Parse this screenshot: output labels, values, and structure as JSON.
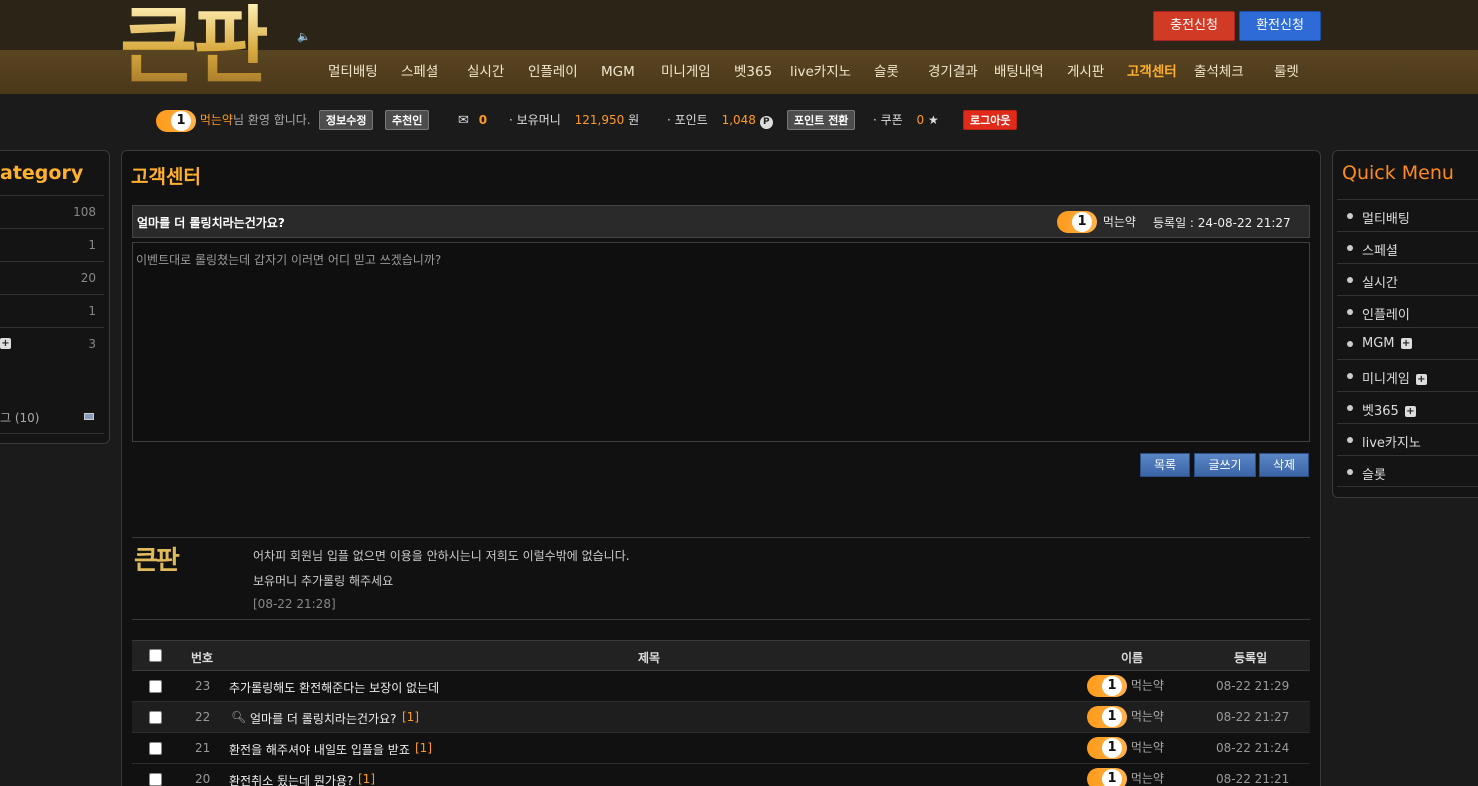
{
  "header": {
    "logo": "큰판",
    "charge_button": "충전신청",
    "exchange_button": "환전신청",
    "nav": [
      "멀티배팅",
      "스페셜",
      "실시간",
      "인플레이",
      "MGM",
      "미니게임",
      "벳365",
      "live카지노",
      "슬롯",
      "경기결과",
      "배팅내역",
      "게시판",
      "고객센터",
      "출석체크",
      "룰렛"
    ],
    "active_nav": "고객센터"
  },
  "userbar": {
    "level": "1",
    "nickname": "먹는약",
    "greeting": "님 환영 합니다.",
    "edit_info": "정보수정",
    "referrer": "추천인",
    "messages": "0",
    "money_label": "· 보유머니",
    "money": "121,950",
    "money_unit": "원",
    "point_label": "· 포인트",
    "points": "1,048",
    "point_convert": "포인트 전환",
    "coupon_label": "· 쿠폰",
    "coupons": "0",
    "logout": "로그아웃"
  },
  "category": {
    "title": "ategory",
    "rows": [
      {
        "label": "",
        "count": "108"
      },
      {
        "label": "",
        "count": "1"
      },
      {
        "label": "",
        "count": "20"
      },
      {
        "label": "",
        "count": "1"
      },
      {
        "label": "",
        "count": "3"
      },
      {
        "label": "",
        "count": ""
      },
      {
        "label": "그 (10)",
        "count": ""
      }
    ]
  },
  "post": {
    "page_title": "고객센터",
    "subject": "얼마를 더 롤링치라는건가요?",
    "author_level": "1",
    "author": "먹는약",
    "date": "등록일 : 24-08-22 21:27",
    "body": "이벤트대로 롤링쳤는데 갑자기 이러면 어디 믿고 쓰겠습니까?",
    "buttons": {
      "list": "목록",
      "write": "글쓰기",
      "delete": "삭제"
    }
  },
  "reply": {
    "logo": "큰판",
    "line1": "어차피 회원님 입플 없으면 이용을 안하시는니 저희도 이럴수밖에 없습니다.",
    "line2": "보유머니 추가롤링 해주세요",
    "time": "[08-22 21:28]"
  },
  "table": {
    "headers": {
      "num": "번호",
      "subject": "제목",
      "name": "이름",
      "date": "등록일"
    },
    "rows": [
      {
        "num": "23",
        "subject": "추가롤링해도 환전해준다는 보장이 없는데",
        "comments": "",
        "level": "1",
        "name": "먹는약",
        "date": "08-22 21:29"
      },
      {
        "num": "22",
        "subject": "얼마를 더 롤링치라는건가요?",
        "comments": "[1]",
        "level": "1",
        "name": "먹는약",
        "date": "08-22 21:27",
        "current": true
      },
      {
        "num": "21",
        "subject": "환전을 해주셔야 내일또 입플을 받죠",
        "comments": "[1]",
        "level": "1",
        "name": "먹는약",
        "date": "08-22 21:24"
      },
      {
        "num": "20",
        "subject": "환전취소 됬는데 뭔가용?",
        "comments": "[1]",
        "level": "1",
        "name": "먹는약",
        "date": "08-22 21:21"
      }
    ]
  },
  "quick_menu": {
    "title": "Quick Menu",
    "items": [
      {
        "label": "멀티배팅",
        "plus": false
      },
      {
        "label": "스페셜",
        "plus": false
      },
      {
        "label": "실시간",
        "plus": false
      },
      {
        "label": "인플레이",
        "plus": false
      },
      {
        "label": "MGM",
        "plus": true
      },
      {
        "label": "미니게임",
        "plus": true
      },
      {
        "label": "벳365",
        "plus": true
      },
      {
        "label": "live카지노",
        "plus": false
      },
      {
        "label": "슬롯",
        "plus": false
      }
    ]
  },
  "colors": {
    "accent": "#ffb02e",
    "header_bg": "#2b2417",
    "nav_bg": "#4a3819",
    "charge": "#d13b25",
    "exchange": "#2f6bd6"
  }
}
